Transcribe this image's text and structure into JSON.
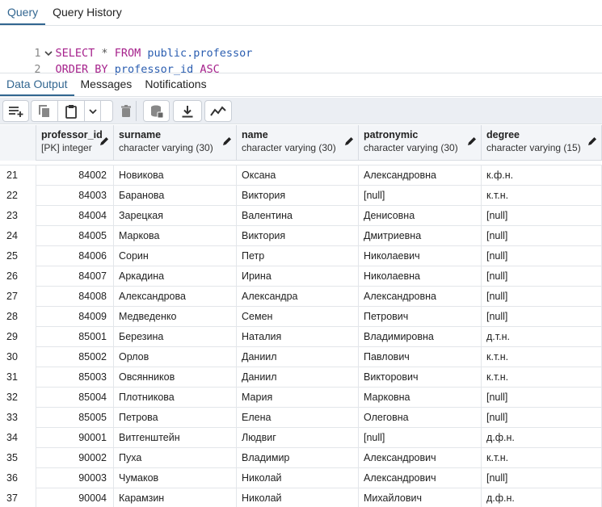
{
  "top_tabs": [
    {
      "label": "Query",
      "active": true
    },
    {
      "label": "Query History",
      "active": false
    }
  ],
  "editor": {
    "lines": [
      {
        "number": "1",
        "parts": [
          [
            "kw",
            "SELECT"
          ],
          [
            "op",
            " * "
          ],
          [
            "kw",
            "FROM"
          ],
          [
            "op",
            " "
          ],
          [
            "id",
            "public.professor"
          ]
        ]
      },
      {
        "number": "2",
        "parts": [
          [
            "kw",
            "ORDER BY"
          ],
          [
            "op",
            " "
          ],
          [
            "id",
            "professor_id"
          ],
          [
            "op",
            " "
          ],
          [
            "kw",
            "ASC"
          ]
        ]
      }
    ]
  },
  "bottom_tabs": [
    {
      "label": "Data Output",
      "active": true
    },
    {
      "label": "Messages",
      "active": false
    },
    {
      "label": "Notifications",
      "active": false
    }
  ],
  "toolbar": {
    "icons": [
      "add-row-icon",
      "copy-icon",
      "paste-icon",
      "dropdown-arrow-icon",
      "delete-icon",
      "save-data-icon",
      "download-icon",
      "graph-icon"
    ]
  },
  "columns": [
    {
      "name": "professor_id",
      "type": "[PK] integer"
    },
    {
      "name": "surname",
      "type": "character varying (30)"
    },
    {
      "name": "name",
      "type": "character varying (30)"
    },
    {
      "name": "patronymic",
      "type": "character varying (30)"
    },
    {
      "name": "degree",
      "type": "character varying (15)"
    }
  ],
  "rows": [
    [
      "21",
      "84002",
      "Новикова",
      "Оксана",
      "Александровна",
      "к.ф.н."
    ],
    [
      "22",
      "84003",
      "Баранова",
      "Виктория",
      "[null]",
      "к.т.н."
    ],
    [
      "23",
      "84004",
      "Зарецкая",
      "Валентина",
      "Денисовна",
      "[null]"
    ],
    [
      "24",
      "84005",
      "Маркова",
      "Виктория",
      "Дмитриевна",
      "[null]"
    ],
    [
      "25",
      "84006",
      "Сорин",
      "Петр",
      "Николаевич",
      "[null]"
    ],
    [
      "26",
      "84007",
      "Аркадина",
      "Ирина",
      "Николаевна",
      "[null]"
    ],
    [
      "27",
      "84008",
      "Александрова",
      "Александра",
      "Александровна",
      "[null]"
    ],
    [
      "28",
      "84009",
      "Медведенко",
      "Семен",
      "Петрович",
      "[null]"
    ],
    [
      "29",
      "85001",
      "Березина",
      "Наталия",
      "Владимировна",
      "д.т.н."
    ],
    [
      "30",
      "85002",
      "Орлов",
      "Даниил",
      "Павлович",
      "к.т.н."
    ],
    [
      "31",
      "85003",
      "Овсянников",
      "Даниил",
      "Викторович",
      "к.т.н."
    ],
    [
      "32",
      "85004",
      "Плотникова",
      "Мария",
      "Марковна",
      "[null]"
    ],
    [
      "33",
      "85005",
      "Петрова",
      "Елена",
      "Олеговна",
      "[null]"
    ],
    [
      "34",
      "90001",
      "Витгенштейн",
      "Людвиг",
      "[null]",
      "д.ф.н."
    ],
    [
      "35",
      "90002",
      "Пуха",
      "Владимир",
      "Александрович",
      "к.т.н."
    ],
    [
      "36",
      "90003",
      "Чумаков",
      "Николай",
      "Александрович",
      "[null]"
    ],
    [
      "37",
      "90004",
      "Карамзин",
      "Николай",
      "Михайлович",
      "д.ф.н."
    ]
  ],
  "colors": {
    "accent": "#326690",
    "keyword": "#a6228c",
    "identifier": "#2a5db0"
  }
}
